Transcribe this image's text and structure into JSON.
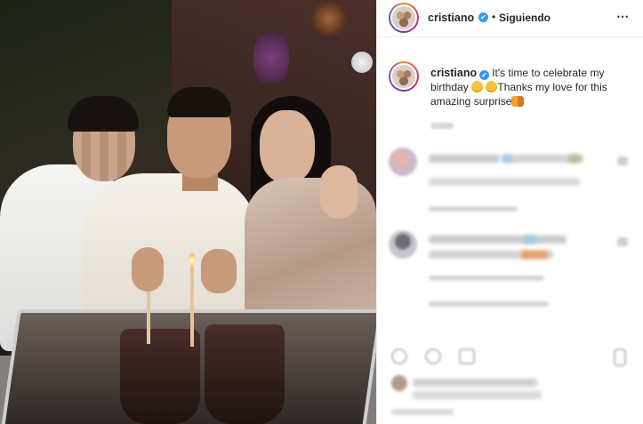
{
  "post": {
    "photo_alt": "",
    "header": {
      "username": "cristiano",
      "verified_mark": "✔",
      "separator": "•",
      "follow_status": "Siguiendo",
      "more_icon": "⋯"
    },
    "caption": {
      "username": "cristiano",
      "verified_mark": "✔",
      "text_part1": "It's time to celebrate my birthday ",
      "text_part2": "Thanks my love for this amazing surprise"
    },
    "icons": {
      "header_more": "more-options-icon",
      "verified": "verified-badge-icon",
      "emoji_face": "smiling-face-emoji-icon",
      "emoji_couple": "couple-emoji-icon"
    },
    "colors": {
      "verified_blue": "#3897f0",
      "text": "#262626",
      "border": "#efefef"
    }
  }
}
